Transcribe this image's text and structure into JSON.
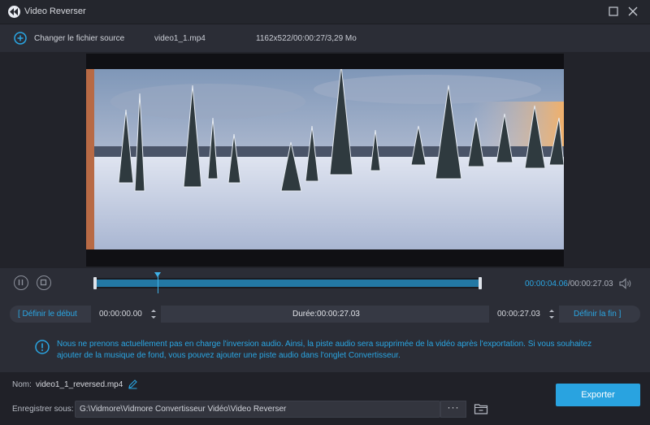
{
  "window": {
    "title": "Video Reverser"
  },
  "toolbar": {
    "change_source_label": "Changer le fichier source",
    "file_name": "video1_1.mp4",
    "file_info": "1162x522/00:00:27/3,29 Mo"
  },
  "playback": {
    "current_time": "00:00:04.06",
    "total_time": "/00:00:27.03",
    "progress_fraction": 0.16
  },
  "cut": {
    "start_button": "[   Définir le début",
    "start_time": "00:00:00.00",
    "duration": "Durée:00:00:27.03",
    "end_time": "00:00:27.03",
    "end_button": "Définir la fin    ]"
  },
  "notice": {
    "text": "Nous ne prenons actuellement pas en charge l'inversion audio. Ainsi, la piste audio sera supprimée de la vidéo après l'exportation. Si vous souhaitez ajouter de la musique de fond, vous pouvez ajouter une piste audio dans l'onglet Convertisseur."
  },
  "output": {
    "name_label": "Nom:",
    "name_value": "video1_1_reversed.mp4",
    "save_label": "Enregistrer sous:",
    "save_path": "G:\\Vidmore\\Vidmore Convertisseur Vidéo\\Video Reverser",
    "browse_label": "···",
    "export_label": "Exporter"
  },
  "icons": {
    "logo": "app-logo-icon",
    "maximize": "maximize-icon",
    "close": "close-icon",
    "add": "add-icon",
    "pause": "pause-icon",
    "stop": "stop-icon",
    "volume": "volume-icon",
    "info": "info-icon",
    "edit": "pencil-icon",
    "folder": "folder-icon"
  },
  "colors": {
    "accent": "#29a3e0",
    "background": "#2b2d36",
    "footer": "#202128"
  }
}
